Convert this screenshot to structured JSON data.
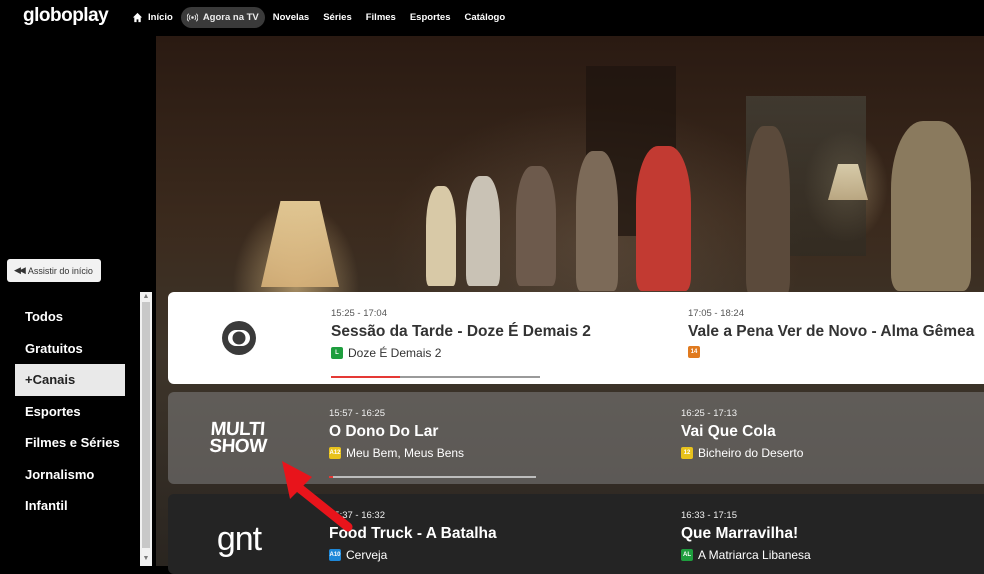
{
  "app": {
    "logo": "globoplay"
  },
  "nav": {
    "items": [
      {
        "label": "Início",
        "icon": "home-icon"
      },
      {
        "label": "Agora na TV",
        "icon": "live-broadcast-icon",
        "active": true
      },
      {
        "label": "Novelas"
      },
      {
        "label": "Séries"
      },
      {
        "label": "Filmes"
      },
      {
        "label": "Esportes"
      },
      {
        "label": "Catálogo"
      }
    ]
  },
  "player": {
    "watch_from_start_label": "Assistir do início",
    "watch_from_start_icon": "rewind-icon"
  },
  "categories": {
    "items": [
      "Todos",
      "Gratuitos",
      "+Canais",
      "Esportes",
      "Filmes e Séries",
      "Jornalismo",
      "Infantil"
    ],
    "active": "+Canais"
  },
  "channels": [
    {
      "logo": "globo-icon",
      "now": {
        "time": "15:25 - 17:04",
        "title": "Sessão da Tarde - Doze É Demais 2",
        "subtitle": "Doze É Demais 2",
        "rating": "L",
        "rating_color": "#1e9e3e",
        "progress": 0.33
      },
      "next": {
        "time": "17:05 - 18:24",
        "title": "Vale a Pena Ver de Novo - Alma Gêmea",
        "subtitle": "",
        "rating": "14",
        "rating_color": "#e07a1f"
      }
    },
    {
      "logo_text": [
        "MULTI",
        "SHOW"
      ],
      "now": {
        "time": "15:57 - 16:25",
        "title": "O Dono Do Lar",
        "subtitle": "Meu Bem, Meus Bens",
        "rating": "A12",
        "rating_color": "#e8c21c",
        "progress": 0.02
      },
      "next": {
        "time": "16:25 - 17:13",
        "title": "Vai Que Cola",
        "subtitle": "Bicheiro do Deserto",
        "rating": "12",
        "rating_color": "#e8c21c"
      }
    },
    {
      "logo_text": [
        "gnt"
      ],
      "now": {
        "time": "15:37 - 16:32",
        "title": "Food Truck - A Batalha",
        "subtitle": "Cerveja",
        "rating": "A10",
        "rating_color": "#1e88d8"
      },
      "next": {
        "time": "16:33 - 17:15",
        "title": "Que Marravilha!",
        "subtitle": "A Matriarca Libanesa",
        "rating": "AL",
        "rating_color": "#1e9e3e"
      }
    }
  ],
  "colors": {
    "progress_live": "#e53935",
    "annotation_arrow": "#e8141b"
  }
}
